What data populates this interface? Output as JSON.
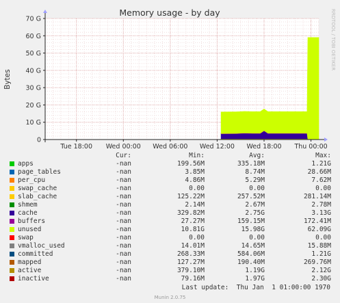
{
  "chart_data": {
    "type": "area",
    "title": "Memory usage - by day",
    "ylabel": "Bytes",
    "ylim": [
      0,
      70
    ],
    "y_unit": "G",
    "yticks": [
      "0",
      "10 G",
      "20 G",
      "30 G",
      "40 G",
      "50 G",
      "60 G",
      "70 G"
    ],
    "xticks": [
      "Tue 18:00",
      "Wed 00:00",
      "Wed 06:00",
      "Wed 12:00",
      "Wed 18:00",
      "Thu 00:00"
    ],
    "x_hours": [
      0,
      6,
      12,
      18,
      24,
      30
    ],
    "xlim_hours": [
      -4,
      31
    ],
    "watermark": "RRDTOOL / TOBI OETIKER",
    "grid": true,
    "series": [
      {
        "name": "apps",
        "color": "#00cc00",
        "x": [
          18.5,
          29.5
        ],
        "values": [
          0.2,
          0.2
        ]
      },
      {
        "name": "page_tables",
        "color": "#0066b3",
        "x": [
          18.5,
          29.5
        ],
        "values": [
          0.01,
          0.01
        ]
      },
      {
        "name": "per_cpu",
        "color": "#ff8000",
        "x": [
          18.5,
          29.5
        ],
        "values": [
          0.005,
          0.005
        ]
      },
      {
        "name": "swap_cache",
        "color": "#ffcc00",
        "x": [
          18.5,
          29.5
        ],
        "values": [
          0.0,
          0.0
        ]
      },
      {
        "name": "slab_cache",
        "color": "#ffcc00",
        "x": [
          18.5,
          29.5
        ],
        "values": [
          0.26,
          0.26
        ]
      },
      {
        "name": "shmem",
        "color": "#008f00",
        "x": [
          18.5,
          29.5
        ],
        "values": [
          0.003,
          0.003
        ]
      },
      {
        "name": "cache",
        "color": "#330099",
        "x": [
          18.5,
          20.5,
          21.5,
          22.5,
          23.5,
          24.0,
          24.5,
          25.5,
          29.5
        ],
        "values": [
          2.8,
          2.9,
          3.1,
          3.0,
          3.0,
          4.5,
          3.0,
          3.0,
          3.0
        ]
      },
      {
        "name": "buffers",
        "color": "#990099",
        "x": [
          18.5,
          29.5
        ],
        "values": [
          0.16,
          0.16
        ]
      },
      {
        "name": "unused",
        "color": "#ccff00",
        "x": [
          18.5,
          29.5,
          29.6,
          31.0
        ],
        "values": [
          12.5,
          12.5,
          59.0,
          59.0
        ]
      }
    ],
    "lines": [
      {
        "name": "swap",
        "color": "#ff0000"
      },
      {
        "name": "vmalloc_used",
        "color": "#808080"
      },
      {
        "name": "committed",
        "color": "#004d80"
      },
      {
        "name": "mapped",
        "color": "#b35a00"
      },
      {
        "name": "active",
        "color": "#b38f00"
      },
      {
        "name": "inactive",
        "color": "#b30000"
      }
    ]
  },
  "legend": {
    "headers": {
      "cur": "Cur:",
      "min": "Min:",
      "avg": "Avg:",
      "max": "Max:"
    },
    "rows": [
      {
        "name": "apps",
        "color": "#00cc00",
        "cur": "-nan",
        "min": "199.56M",
        "avg": "335.18M",
        "max": "1.21G"
      },
      {
        "name": "page_tables",
        "color": "#0066b3",
        "cur": "-nan",
        "min": "3.85M",
        "avg": "8.74M",
        "max": "28.66M"
      },
      {
        "name": "per_cpu",
        "color": "#ff8000",
        "cur": "-nan",
        "min": "4.86M",
        "avg": "5.29M",
        "max": "7.62M"
      },
      {
        "name": "swap_cache",
        "color": "#ffcc00",
        "cur": "-nan",
        "min": "0.00",
        "avg": "0.00",
        "max": "0.00"
      },
      {
        "name": "slab_cache",
        "color": "#ffcc00",
        "cur": "-nan",
        "min": "125.22M",
        "avg": "257.52M",
        "max": "281.14M"
      },
      {
        "name": "shmem",
        "color": "#008f00",
        "cur": "-nan",
        "min": "2.14M",
        "avg": "2.67M",
        "max": "2.78M"
      },
      {
        "name": "cache",
        "color": "#330099",
        "cur": "-nan",
        "min": "329.82M",
        "avg": "2.75G",
        "max": "3.13G"
      },
      {
        "name": "buffers",
        "color": "#990099",
        "cur": "-nan",
        "min": "27.27M",
        "avg": "159.15M",
        "max": "172.41M"
      },
      {
        "name": "unused",
        "color": "#ccff00",
        "cur": "-nan",
        "min": "10.81G",
        "avg": "15.98G",
        "max": "62.09G"
      },
      {
        "name": "swap",
        "color": "#ff0000",
        "cur": "-nan",
        "min": "0.00",
        "avg": "0.00",
        "max": "0.00"
      },
      {
        "name": "vmalloc_used",
        "color": "#808080",
        "cur": "-nan",
        "min": "14.01M",
        "avg": "14.65M",
        "max": "15.88M"
      },
      {
        "name": "committed",
        "color": "#004d80",
        "cur": "-nan",
        "min": "268.33M",
        "avg": "584.06M",
        "max": "1.21G"
      },
      {
        "name": "mapped",
        "color": "#b35a00",
        "cur": "-nan",
        "min": "127.27M",
        "avg": "190.40M",
        "max": "269.76M"
      },
      {
        "name": "active",
        "color": "#b38f00",
        "cur": "-nan",
        "min": "379.10M",
        "avg": "1.19G",
        "max": "2.12G"
      },
      {
        "name": "inactive",
        "color": "#b30000",
        "cur": "-nan",
        "min": "79.16M",
        "avg": "1.97G",
        "max": "2.30G"
      }
    ]
  },
  "footer": {
    "last_update": "Last update:  Thu Jan  1 01:00:00 1970",
    "version": "Munin 2.0.75"
  }
}
